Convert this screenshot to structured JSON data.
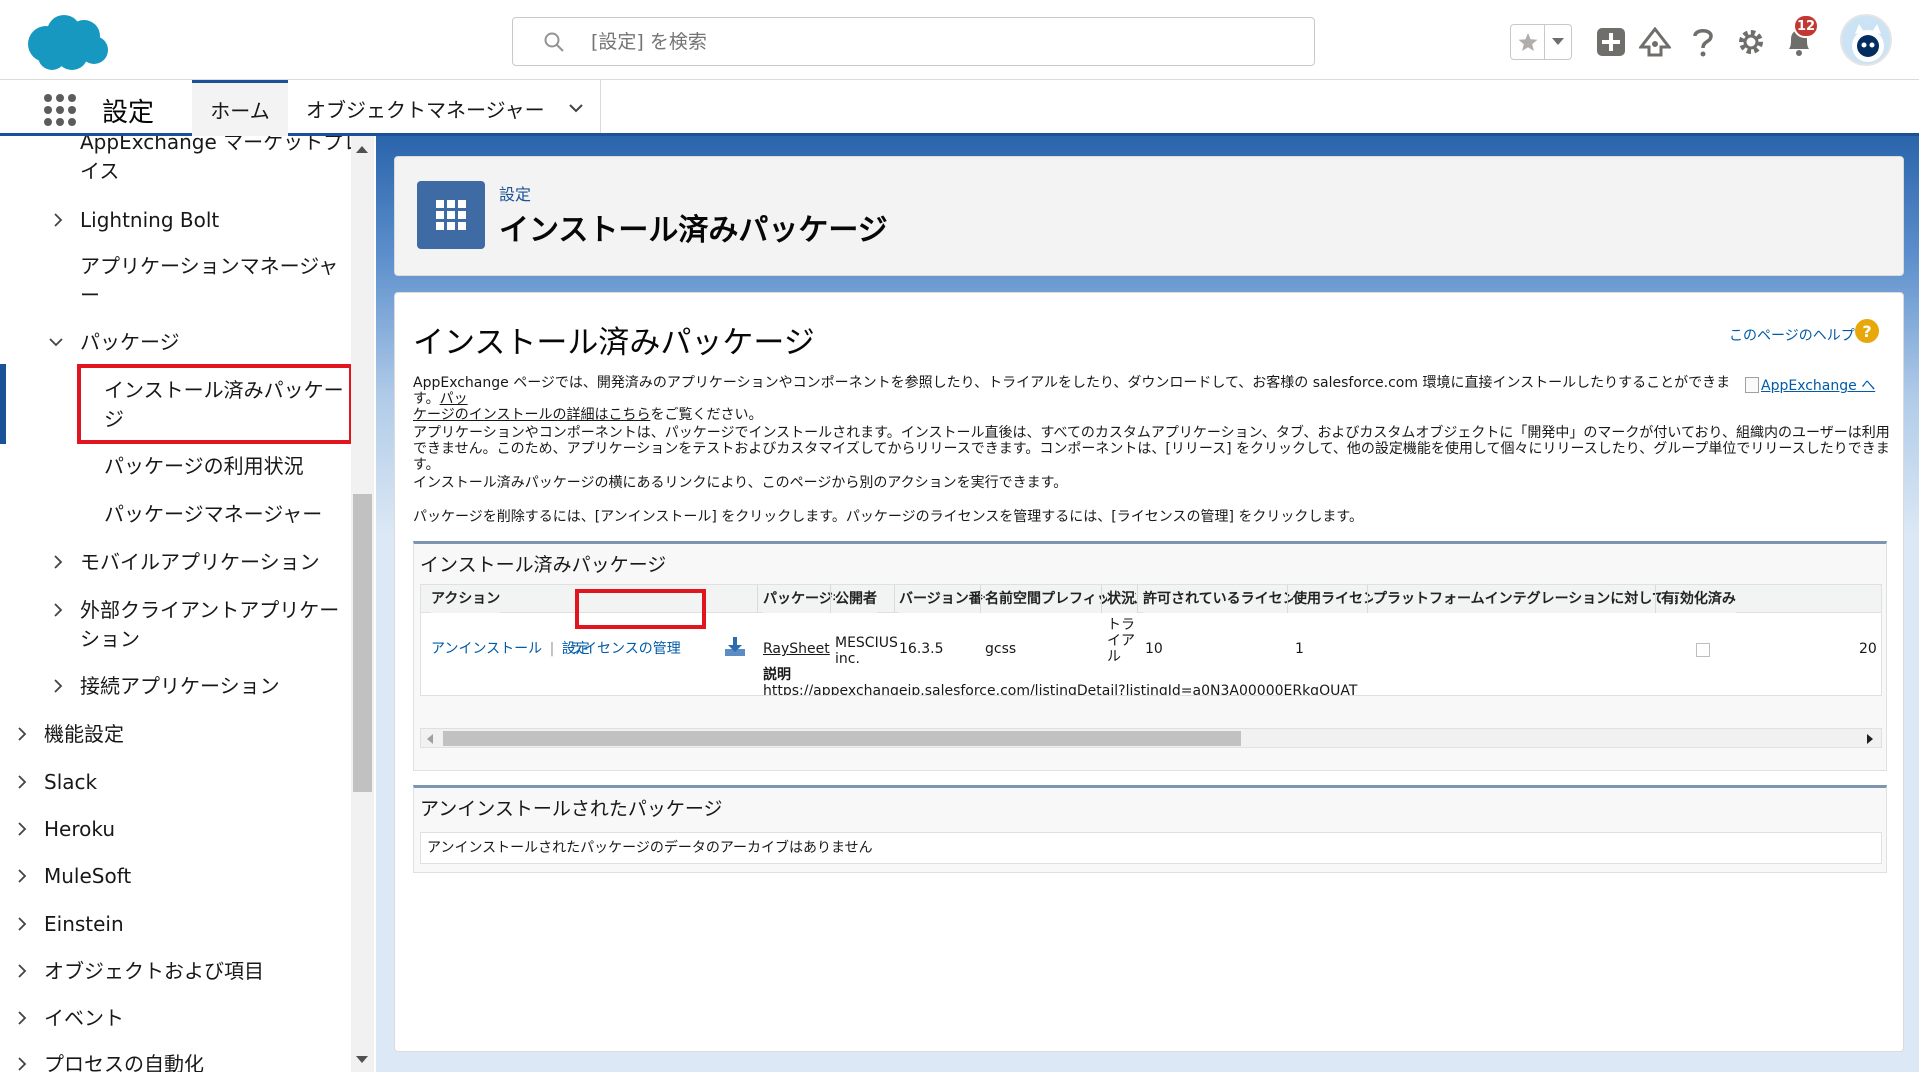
{
  "header": {
    "search_placeholder": "[設定] を検索",
    "notification_count": "12",
    "colors": {
      "brand": "#1b5297",
      "cloud": "#1798c1",
      "alert": "#c23934"
    }
  },
  "context_bar": {
    "app_name": "設定",
    "tabs": [
      {
        "label": "ホーム",
        "active": true
      },
      {
        "label": "オブジェクトマネージャー",
        "active": false
      }
    ]
  },
  "sidebar": {
    "items": [
      {
        "label": "AppExchange マーケットプレ",
        "label2": "イス"
      },
      {
        "label": "Lightning Bolt"
      },
      {
        "label": "アプリケーションマネージャ",
        "label2": "ー"
      },
      {
        "label": "パッケージ"
      },
      {
        "label": "インストール済みパッケー",
        "label2": "ジ"
      },
      {
        "label": "パッケージの利用状況"
      },
      {
        "label": "パッケージマネージャー"
      },
      {
        "label": "モバイルアプリケーション"
      },
      {
        "label": "外部クライアントアプリケー",
        "label2": "ション"
      },
      {
        "label": "接続アプリケーション"
      },
      {
        "label": "機能設定"
      },
      {
        "label": "Slack"
      },
      {
        "label": "Heroku"
      },
      {
        "label": "MuleSoft"
      },
      {
        "label": "Einstein"
      },
      {
        "label": "オブジェクトおよび項目"
      },
      {
        "label": "イベント"
      },
      {
        "label": "プロセスの自動化"
      }
    ]
  },
  "page_header": {
    "eyebrow": "設定",
    "title": "インストール済みパッケージ"
  },
  "main": {
    "title": "インストール済みパッケージ",
    "help_link": "このページのヘルプ",
    "p1_a": "AppExchange ページでは、開発済みのアプリケーションやコンポーネントを参照したり、トライアルをしたり、ダウンロードして、お客様の salesforce.com 環境に直接インストールしたりすることができます。",
    "p1_link_a": "パッ",
    "p1_link_b": "ケージのインストールの詳細はこちら",
    "p1_b": "をご覧ください。",
    "appexchange_img_alt": "AppExchange へ",
    "p2": "アプリケーションやコンポーネントは、パッケージでインストールされます。インストール直後は、すべてのカスタムアプリケーション、タブ、およびカスタムオブジェクトに「開発中」のマークが付いており、組織内のユーザーは利用できません。このため、アプリケーションをテストおよびカスタマイズしてからリリースできます。コンポーネントは、[リリース] をクリックして、他の設定機能を使用して個々にリリースしたり、グループ単位でリリースしたりできます。",
    "p3": "インストール済みパッケージの横にあるリンクにより、このページから別のアクションを実行できます。",
    "p4": "パッケージを削除するには、[アンインストール] をクリックします。パッケージのライセンスを管理するには、[ライセンスの管理] をクリックします。"
  },
  "installed": {
    "title": "インストール済みパッケージ",
    "columns": [
      "アクション",
      "パッケージ名",
      "公開者",
      "バージョン番号",
      "名前空間プレフィックス",
      "状況",
      "許可されているライセンス数",
      "使用ライセンス",
      "プラットフォームインテグレーションに対して有効化済み",
      "有"
    ],
    "row": {
      "uninstall": "アンインストール",
      "sep": "|",
      "settings": "設定",
      "manage_license": "ライセンスの管理",
      "package_name": "RaySheet",
      "publisher_1": "MESCIUS",
      "publisher_2": "inc.",
      "version": "16.3.5",
      "namespace": "gcss",
      "status_1": "トラ",
      "status_2": "イア",
      "status_3": "ル",
      "allowed": "10",
      "used": "1",
      "last": "20",
      "desc_label": "説明",
      "desc_value": "https://appexchangejp.salesforce.com/listingDetail?listingId=a0N3A00000ERkgOUAT"
    }
  },
  "uninstalled": {
    "title": "アンインストールされたパッケージ",
    "empty": "アンインストールされたパッケージのデータのアーカイブはありません"
  }
}
